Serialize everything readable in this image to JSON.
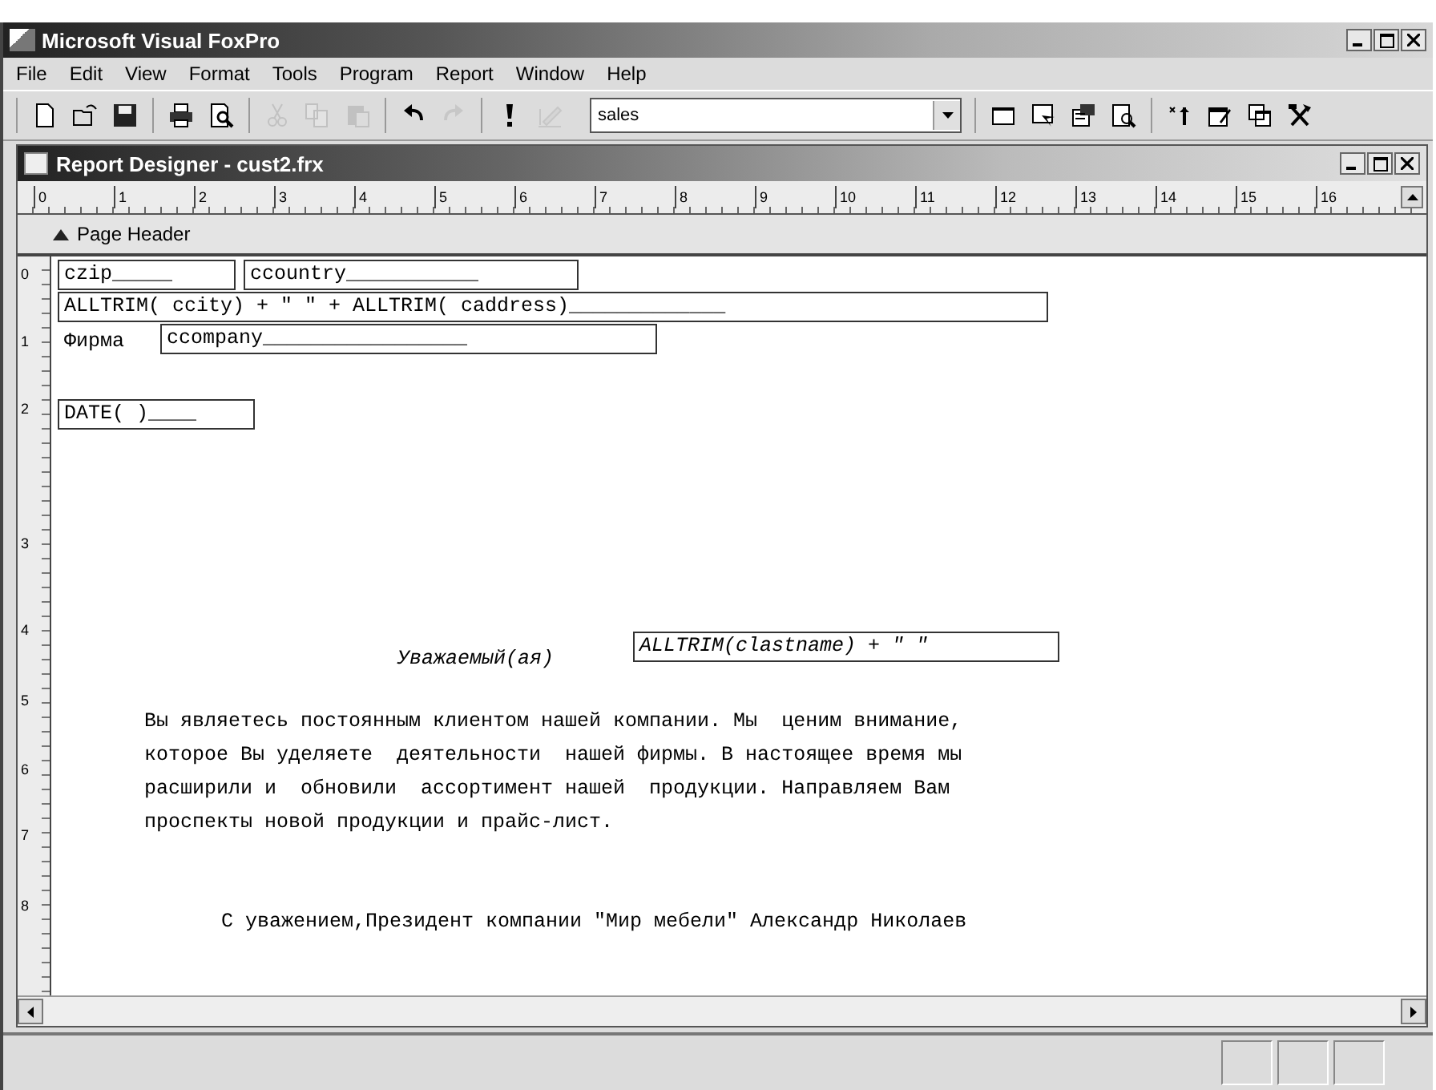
{
  "app": {
    "title": "Microsoft Visual FoxPro"
  },
  "menu": [
    {
      "label": "File"
    },
    {
      "label": "Edit"
    },
    {
      "label": "View"
    },
    {
      "label": "Format"
    },
    {
      "label": "Tools"
    },
    {
      "label": "Program"
    },
    {
      "label": "Report"
    },
    {
      "label": "Window"
    },
    {
      "label": "Help"
    }
  ],
  "toolbar": {
    "groups": [
      [
        {
          "kind": "new",
          "disabled": false
        },
        {
          "kind": "open",
          "disabled": false
        },
        {
          "kind": "save",
          "disabled": false
        }
      ],
      [
        {
          "kind": "print",
          "disabled": false
        },
        {
          "kind": "preview",
          "disabled": false
        }
      ],
      [
        {
          "kind": "cut",
          "disabled": true
        },
        {
          "kind": "copy",
          "disabled": true
        },
        {
          "kind": "paste",
          "disabled": true
        }
      ],
      [
        {
          "kind": "undo",
          "disabled": false
        },
        {
          "kind": "redo",
          "disabled": true
        }
      ],
      [
        {
          "kind": "run",
          "disabled": false
        },
        {
          "kind": "modify",
          "disabled": true
        }
      ]
    ],
    "combo": {
      "value": "sales"
    },
    "tools": [
      {
        "kind": "window",
        "disabled": false
      },
      {
        "kind": "form",
        "disabled": false
      },
      {
        "kind": "properties",
        "disabled": false
      },
      {
        "kind": "inspect",
        "disabled": false
      },
      {
        "kind": "wizard",
        "disabled": false
      },
      {
        "kind": "builder",
        "disabled": false
      },
      {
        "kind": "layout",
        "disabled": false
      },
      {
        "kind": "tools",
        "disabled": false
      }
    ]
  },
  "report_window": {
    "title": "Report Designer - cust2.frx",
    "ruler": [
      "0",
      "1",
      "2",
      "3",
      "4",
      "5",
      "6",
      "7",
      "8",
      "9",
      "10",
      "11",
      "12",
      "13",
      "14",
      "15",
      "16"
    ],
    "band": {
      "label": "Page Header"
    },
    "vertical_ruler": [
      "0",
      "1",
      "2",
      "3",
      "4",
      "5",
      "6",
      "7",
      "8"
    ],
    "items": [
      {
        "kind": "field",
        "text": "czip_____"
      },
      {
        "kind": "field",
        "text": "ccountry___________"
      },
      {
        "kind": "field",
        "text": "ALLTRIM( ccity) + \" \" + ALLTRIM( caddress)_____________"
      },
      {
        "kind": "label",
        "text": "Фирма"
      },
      {
        "kind": "field",
        "text": "ccompany_________________"
      },
      {
        "kind": "field",
        "text": "DATE( )____"
      },
      {
        "kind": "label",
        "italic": true,
        "text": "Уважаемый(ая)"
      },
      {
        "kind": "field",
        "italic": true,
        "text": "ALLTRIM(clastname) + \" \""
      },
      {
        "kind": "label",
        "text": "Вы являетесь постоянным клиентом нашей компании. Мы  ценим внимание,\nкоторое Вы уделяете  деятельности  нашей фирмы. В настоящее время мы\nрасширили и  обновили  ассортимент нашей  продукции. Направляем Вам\nпроспекты новой продукции и прайс-лист."
      },
      {
        "kind": "label",
        "text": "С уважением,Президент компании \"Мир мебели\" Александр Николаев"
      }
    ]
  }
}
